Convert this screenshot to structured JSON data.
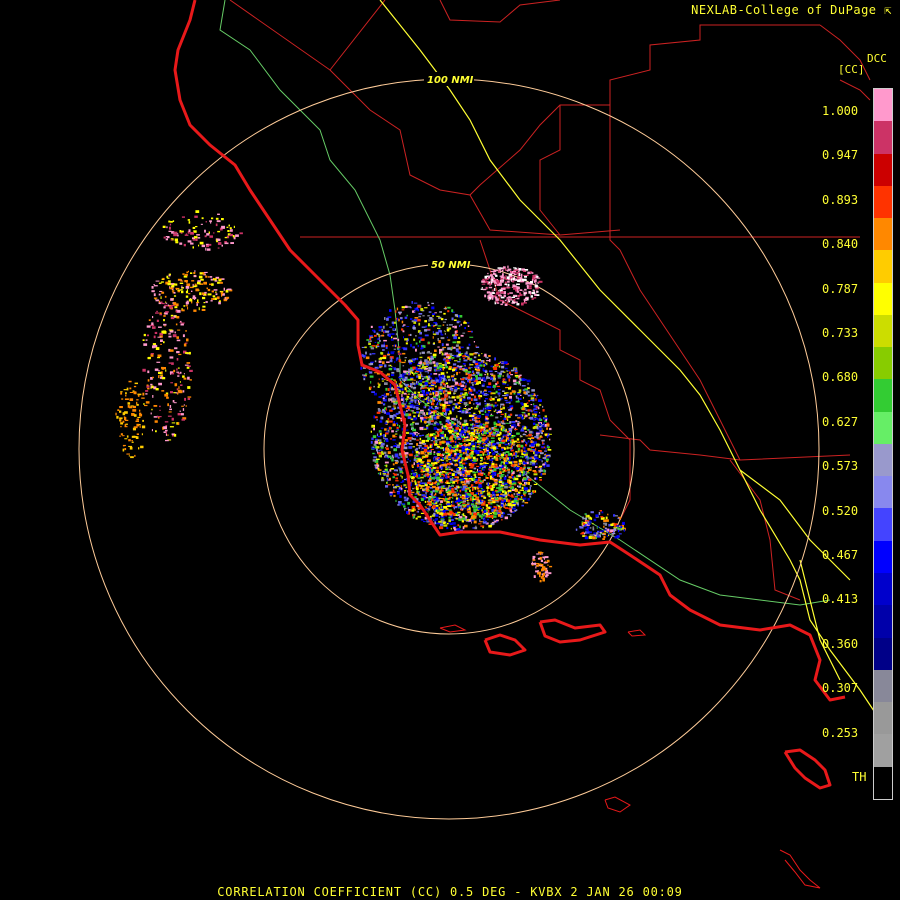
{
  "header": {
    "credit": "NEXLAB-College of DuPage",
    "credit_icon": "pointer-arrow-icon"
  },
  "legend": {
    "product_code": "DCC",
    "unit": "[CC]",
    "ticks": [
      "1.000",
      "0.947",
      "0.893",
      "0.840",
      "0.787",
      "0.733",
      "0.680",
      "0.627",
      "0.573",
      "0.520",
      "0.467",
      "0.413",
      "0.360",
      "0.307",
      "0.253",
      "TH"
    ],
    "color_stops": [
      "#ff99cc",
      "#cc3366",
      "#cc0000",
      "#ff3300",
      "#ff8800",
      "#ffcc00",
      "#ffff00",
      "#ccdd00",
      "#88cc00",
      "#33cc33",
      "#66ee66",
      "#9999cc",
      "#8888ee",
      "#4444ff",
      "#0000ff",
      "#0000cc",
      "#0000aa",
      "#000088",
      "#888899",
      "#999999",
      "#a0a0a0",
      "#000000"
    ]
  },
  "range_rings": [
    {
      "label": "50 NMI"
    },
    {
      "label": "100 NMI"
    }
  ],
  "colors": {
    "coastline": "#e8191a",
    "county": "#cc2222",
    "highway": "#ffff33",
    "state_road": "#66cc66",
    "ring": "#ffcc99",
    "text": "#ffff33"
  },
  "footer": {
    "caption": "CORRELATION COEFFICIENT (CC) 0.5 DEG - KVBX 2 JAN 26 00:09"
  }
}
